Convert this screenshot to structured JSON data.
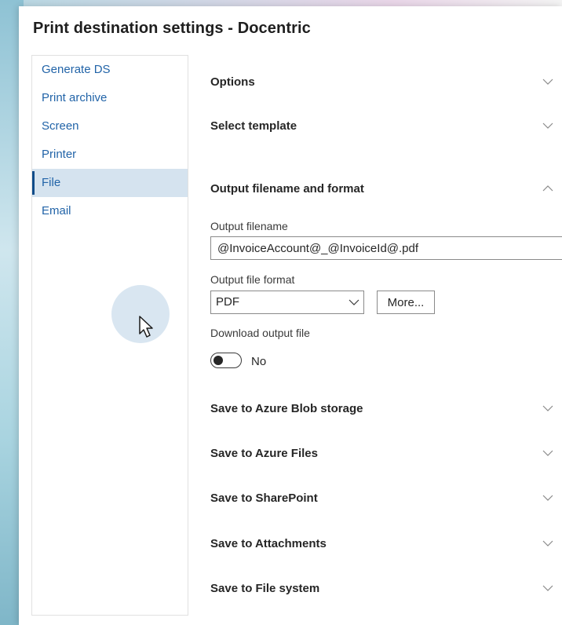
{
  "dialog": {
    "title": "Print destination settings - Docentric"
  },
  "nav": {
    "items": [
      {
        "label": "Generate DS",
        "active": false
      },
      {
        "label": "Print archive",
        "active": false
      },
      {
        "label": "Screen",
        "active": false
      },
      {
        "label": "Printer",
        "active": false
      },
      {
        "label": "File",
        "active": true
      },
      {
        "label": "Email",
        "active": false
      }
    ]
  },
  "sections": {
    "options": {
      "label": "Options",
      "expanded": false,
      "icon": "chevron-down-icon"
    },
    "select_template": {
      "label": "Select template",
      "expanded": false,
      "icon": "chevron-down-icon"
    },
    "output": {
      "label": "Output filename and format",
      "expanded": true,
      "icon": "chevron-up-icon"
    },
    "azure_blob": {
      "label": "Save to Azure Blob storage",
      "expanded": false,
      "icon": "chevron-down-icon"
    },
    "azure_files": {
      "label": "Save to Azure Files",
      "expanded": false,
      "icon": "chevron-down-icon"
    },
    "sharepoint": {
      "label": "Save to SharePoint",
      "expanded": false,
      "icon": "chevron-down-icon"
    },
    "attachments": {
      "label": "Save to Attachments",
      "expanded": false,
      "icon": "chevron-down-icon"
    },
    "file_system": {
      "label": "Save to File system",
      "expanded": false,
      "icon": "chevron-down-icon"
    }
  },
  "output": {
    "filename_label": "Output filename",
    "filename_value": "@InvoiceAccount@_@InvoiceId@.pdf",
    "format_label": "Output file format",
    "format_value": "PDF",
    "more_button": "More...",
    "download_label": "Download output file",
    "download_toggle_text": "No",
    "download_enabled": false
  },
  "colors": {
    "link": "#2264a8",
    "active_nav_bg": "#d5e3ef",
    "active_nav_bar": "#0f4c8a"
  }
}
